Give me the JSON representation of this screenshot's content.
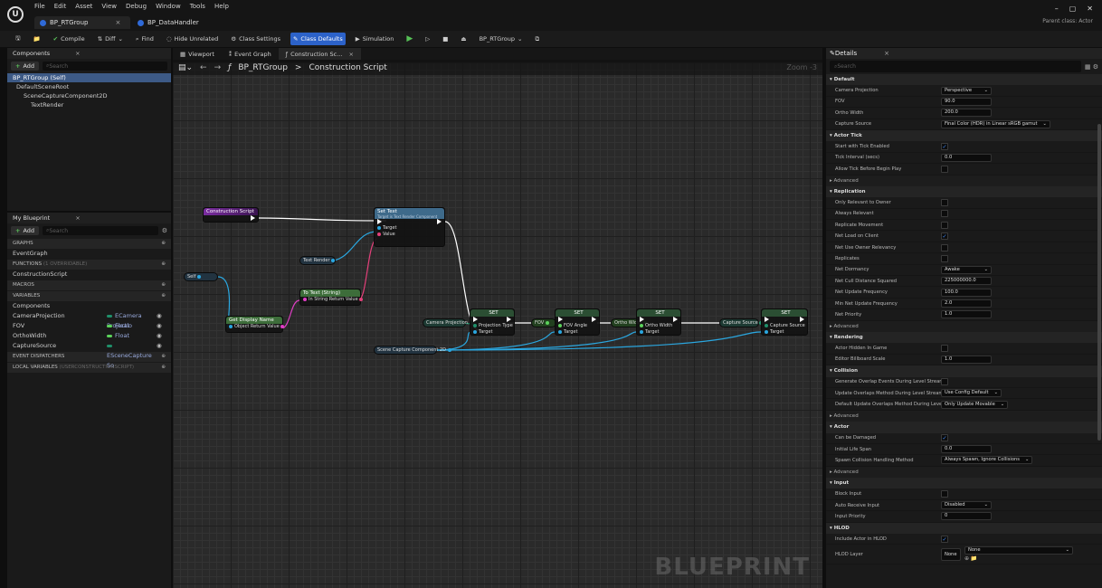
{
  "menu": [
    "File",
    "Edit",
    "Asset",
    "View",
    "Debug",
    "Window",
    "Tools",
    "Help"
  ],
  "logo": "U",
  "window": {
    "tabs": [
      {
        "label": "BP_RTGroup",
        "close": "×"
      },
      {
        "label": "BP_DataHandler"
      }
    ],
    "parent_class": "Parent class: Actor",
    "controls": [
      "–",
      "▢",
      "✕"
    ]
  },
  "toolbar": {
    "compile": "Compile",
    "diff": "Diff",
    "find": "Find",
    "hide_unrelated": "Hide Unrelated",
    "class_settings": "Class Settings",
    "class_defaults": "Class Defaults",
    "simulation": "Simulation",
    "debug_object": "BP_RTGroup"
  },
  "components": {
    "title": "Components",
    "add": "Add",
    "search_placeholder": "Search",
    "tree": [
      "BP_RTGroup (Self)",
      "DefaultSceneRoot",
      "SceneCaptureComponent2D",
      "TextRender"
    ]
  },
  "mybp": {
    "title": "My Blueprint",
    "add": "Add",
    "search_placeholder": "Search",
    "graphs": "GRAPHS",
    "event_graph": "EventGraph",
    "functions": "FUNCTIONS",
    "functions_note": "(1 OVERRIDABLE)",
    "construction": "ConstructionScript",
    "macros": "MACROS",
    "variables": "VARIABLES",
    "components_cat": "Components",
    "vars": [
      {
        "name": "CameraProjection",
        "type": "ECamera Projectio",
        "color": "#1f8f6a"
      },
      {
        "name": "FOV",
        "type": "Float",
        "color": "#5bd25b"
      },
      {
        "name": "OrthoWidth",
        "type": "Float",
        "color": "#5bd25b"
      },
      {
        "name": "CaptureSource",
        "type": "ESceneCapture So",
        "color": "#1f8f6a"
      }
    ],
    "dispatchers": "EVENT DISPATCHERS",
    "locals": "LOCAL VARIABLES",
    "locals_note": "(USERCONSTRUCTIONSCRIPT)"
  },
  "graph": {
    "tabs": [
      "Viewport",
      "Event Graph",
      "Construction Sc..."
    ],
    "breadcrumb_root": "BP_RTGroup",
    "breadcrumb_sep": ">",
    "breadcrumb_leaf": "Construction Script",
    "zoom": "Zoom -3",
    "watermark": "BLUEPRINT",
    "nodes": {
      "construction": "Construction Script",
      "settext": "Set Text",
      "settext_sub": "Target is Text Render Component",
      "target": "Target",
      "value": "Value",
      "textrender": "Text Render",
      "self": "Self",
      "getdisplayname": "Get Display Name",
      "object": "Object",
      "return": "Return Value",
      "totext": "To Text (String)",
      "instring": "In String",
      "set": "SET",
      "projection_type": "Projection Type",
      "fov_angle": "FOV Angle",
      "ortho_width": "Ortho Width",
      "capture_source": "Capture Source",
      "camproj_var": "Camera Projection",
      "fov_var": "FOV",
      "ortho_var": "Ortho Width",
      "capsrc_var": "Capture Source",
      "scenecap": "Scene Capture Component 2D"
    }
  },
  "details": {
    "title": "Details",
    "search_placeholder": "Search",
    "rows": [
      {
        "k": "cat",
        "t": "Default"
      },
      {
        "k": "dd",
        "t": "Camera Projection",
        "v": "Perspective"
      },
      {
        "k": "in",
        "t": "FOV",
        "v": "90.0"
      },
      {
        "k": "in",
        "t": "Ortho Width",
        "v": "200.0"
      },
      {
        "k": "dd",
        "t": "Capture Source",
        "v": "Final Color (HDR) in Linear sRGB gamut"
      },
      {
        "k": "cat",
        "t": "Actor Tick"
      },
      {
        "k": "ck",
        "t": "Start with Tick Enabled",
        "v": "✓"
      },
      {
        "k": "in",
        "t": "Tick Interval (secs)",
        "v": "0.0"
      },
      {
        "k": "ck",
        "t": "Allow Tick Before Begin Play",
        "v": ""
      },
      {
        "k": "sub",
        "t": "Advanced"
      },
      {
        "k": "cat",
        "t": "Replication"
      },
      {
        "k": "ck",
        "t": "Only Relevant to Owner",
        "v": ""
      },
      {
        "k": "ck",
        "t": "Always Relevant",
        "v": ""
      },
      {
        "k": "ck",
        "t": "Replicate Movement",
        "v": ""
      },
      {
        "k": "ck",
        "t": "Net Load on Client",
        "v": "✓"
      },
      {
        "k": "ck",
        "t": "Net Use Owner Relevancy",
        "v": ""
      },
      {
        "k": "ck",
        "t": "Replicates",
        "v": ""
      },
      {
        "k": "dd",
        "t": "Net Dormancy",
        "v": "Awake"
      },
      {
        "k": "in",
        "t": "Net Cull Distance Squared",
        "v": "225000000.0"
      },
      {
        "k": "in",
        "t": "Net Update Frequency",
        "v": "100.0"
      },
      {
        "k": "in",
        "t": "Min Net Update Frequency",
        "v": "2.0"
      },
      {
        "k": "in",
        "t": "Net Priority",
        "v": "1.0"
      },
      {
        "k": "sub",
        "t": "Advanced"
      },
      {
        "k": "cat",
        "t": "Rendering"
      },
      {
        "k": "ck",
        "t": "Actor Hidden In Game",
        "v": ""
      },
      {
        "k": "in",
        "t": "Editor Billboard Scale",
        "v": "1.0"
      },
      {
        "k": "cat",
        "t": "Collision"
      },
      {
        "k": "ck",
        "t": "Generate Overlap Events During Level Streami...",
        "v": ""
      },
      {
        "k": "dd",
        "t": "Update Overlaps Method During Level Streami...",
        "v": "Use Config Default"
      },
      {
        "k": "dd",
        "t": "Default Update Overlaps Method During Level...",
        "v": "Only Update Movable"
      },
      {
        "k": "sub",
        "t": "Advanced"
      },
      {
        "k": "cat",
        "t": "Actor"
      },
      {
        "k": "ck",
        "t": "Can be Damaged",
        "v": "✓"
      },
      {
        "k": "in",
        "t": "Initial Life Span",
        "v": "0.0"
      },
      {
        "k": "dd",
        "t": "Spawn Collision Handling Method",
        "v": "Always Spawn, Ignore Collisions"
      },
      {
        "k": "sub",
        "t": "Advanced"
      },
      {
        "k": "cat",
        "t": "Input"
      },
      {
        "k": "ck",
        "t": "Block Input",
        "v": ""
      },
      {
        "k": "dd",
        "t": "Auto Receive Input",
        "v": "Disabled"
      },
      {
        "k": "in",
        "t": "Input Priority",
        "v": "0"
      },
      {
        "k": "cat",
        "t": "HLOD"
      },
      {
        "k": "ck",
        "t": "Include Actor in HLOD",
        "v": "✓"
      }
    ],
    "hlod_layer": "HLOD Layer",
    "hlod_none": "None",
    "hlod_none2": "None"
  }
}
